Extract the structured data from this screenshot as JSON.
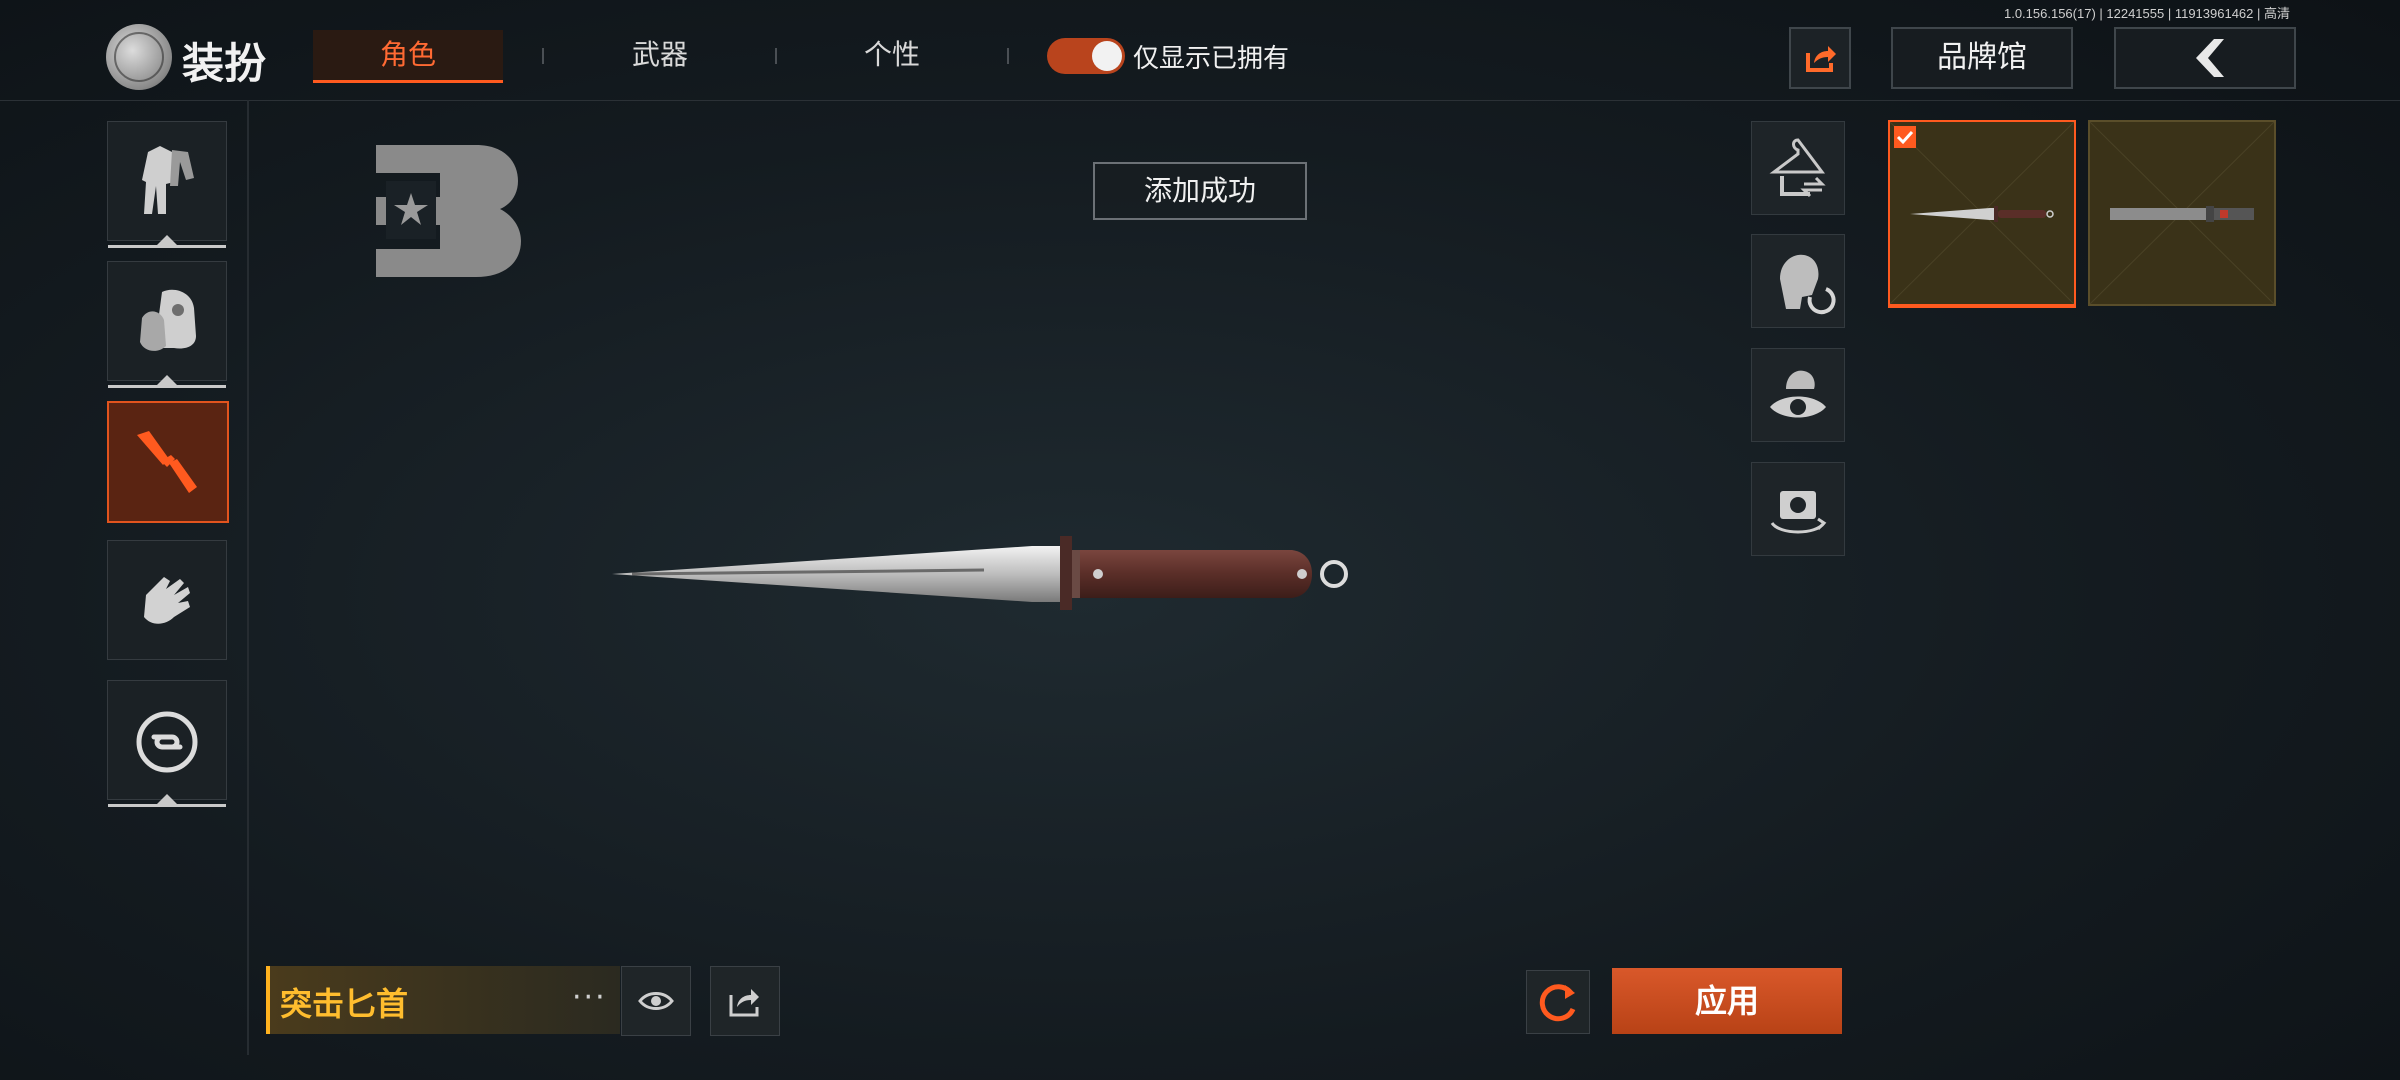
{
  "version_text": "1.0.156.156(17) | 12241555 | 11913961462 | 高清",
  "header": {
    "title": "装扮",
    "tabs": [
      "角色",
      "武器",
      "个性"
    ],
    "active_tab": 0,
    "toggle_label": "仅显示已拥有",
    "toggle_on": true,
    "brand_button": "品牌馆"
  },
  "sidebar": {
    "items": [
      {
        "icon": "outfit-icon",
        "active": false
      },
      {
        "icon": "backpack-icon",
        "active": false
      },
      {
        "icon": "knife-icon",
        "active": true
      },
      {
        "icon": "glove-icon",
        "active": false
      },
      {
        "icon": "link-icon",
        "active": false
      }
    ]
  },
  "toast": "添加成功",
  "right_actions": [
    "hanger-swap-icon",
    "head-rotate-icon",
    "preview-eye-icon",
    "camera-rotate-icon"
  ],
  "skins": [
    {
      "selected": true
    },
    {
      "selected": false
    }
  ],
  "item": {
    "name": "突击匕首",
    "more": "···"
  },
  "apply_button": "应用",
  "colors": {
    "accent": "#ff5a1f",
    "gold": "#ffbd2e"
  }
}
